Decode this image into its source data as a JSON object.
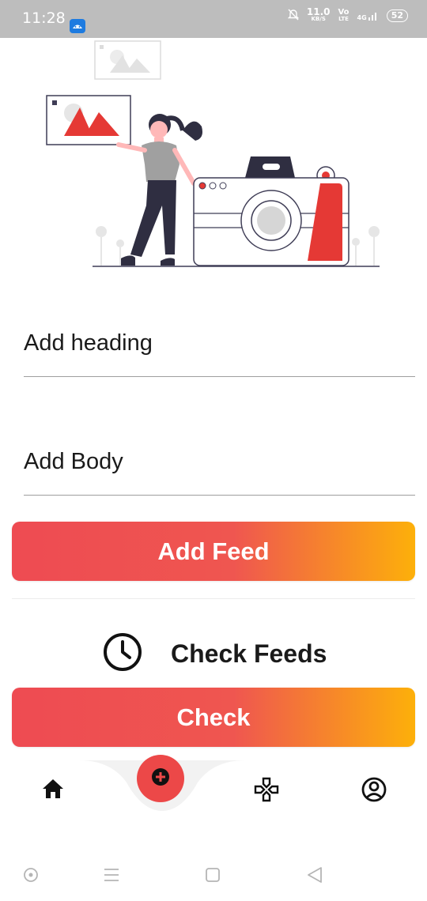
{
  "status_bar": {
    "time": "11:28",
    "net_speed_value": "11.0",
    "net_speed_unit": "KB/S",
    "volte_top": "Vo",
    "volte_bottom": "LTE",
    "network": "4G",
    "battery": "52"
  },
  "form": {
    "heading_placeholder": "Add heading",
    "body_placeholder": "Add Body",
    "add_feed_label": "Add Feed"
  },
  "check_section": {
    "label": "Check Feeds",
    "check_label": "Check"
  },
  "bottom_nav": {
    "items": [
      "home-icon",
      "add-icon",
      "gamepad-icon",
      "account-icon"
    ]
  },
  "colors": {
    "accent_red": "#ec4848",
    "gradient_start": "#ee4b52",
    "gradient_end": "#fdb00a",
    "status_bar": "#bdbdbd"
  }
}
